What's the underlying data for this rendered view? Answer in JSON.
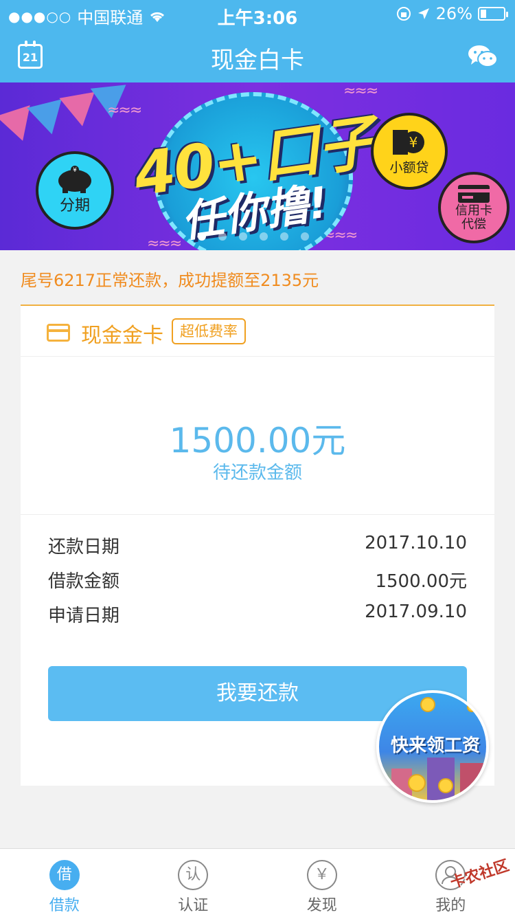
{
  "status_bar": {
    "carrier": "中国联通",
    "time": "上午3:06",
    "battery": "26%",
    "battery_level": 0.26
  },
  "nav": {
    "title": "现金白卡",
    "calendar_day": "21"
  },
  "banner": {
    "headline": "40+口子",
    "subline": "任你撸!",
    "badges": [
      "分期",
      "小额贷",
      "信用卡代偿"
    ],
    "page_count": 6,
    "active_page": 0
  },
  "notice": "尾号6217正常还款，成功提额至2135元",
  "card": {
    "title": "现金金卡",
    "tag": "超低费率",
    "amount": "1500.00元",
    "amount_label": "待还款金额",
    "details": [
      {
        "label": "还款日期",
        "value": "2017.10.10"
      },
      {
        "label": "借款金额",
        "value": "1500.00元"
      },
      {
        "label": "申请日期",
        "value": "2017.09.10"
      }
    ],
    "repay_button": "我要还款"
  },
  "promo": {
    "text": "快来领工资"
  },
  "tabs": [
    {
      "icon_char": "借",
      "label": "借款",
      "active": true
    },
    {
      "icon_char": "认",
      "label": "认证",
      "active": false
    },
    {
      "icon_char": "￥",
      "label": "发现",
      "active": false
    },
    {
      "icon_char": "",
      "label": "我的",
      "active": false
    }
  ],
  "watermark": "卡农社区",
  "colors": {
    "primary": "#4db8ee",
    "accent": "#f0a020",
    "amount": "#5bb9ec"
  }
}
